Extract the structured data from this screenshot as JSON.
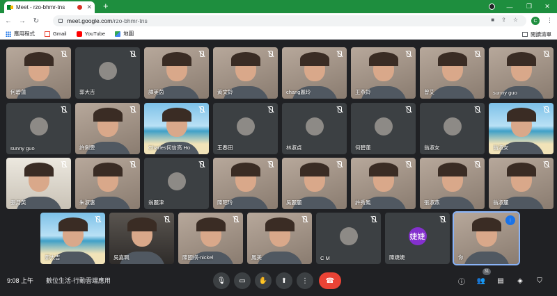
{
  "browser": {
    "tab_title": "Meet - rzo-bhmr-tns",
    "url_host": "meet.google.com",
    "url_path": "/rzo-bhmr-tns",
    "profile_letter": "C",
    "bookmarks": [
      {
        "label": "應用程式",
        "icon": "apps-grid-icon"
      },
      {
        "label": "Gmail",
        "icon": "gmail-icon"
      },
      {
        "label": "YouTube",
        "icon": "youtube-icon"
      },
      {
        "label": "地圖",
        "icon": "maps-icon"
      }
    ],
    "reading_list": "閱讀清單"
  },
  "meeting": {
    "time": "9:08 上午",
    "title": "數位生活-行動雲端應用",
    "participant_count": "31"
  },
  "participants": [
    {
      "name": "何碧蓮",
      "kind": "video"
    },
    {
      "name": "郭大吉",
      "kind": "avatar"
    },
    {
      "name": "譚美茵",
      "kind": "video"
    },
    {
      "name": "黃文鈴",
      "kind": "video"
    },
    {
      "name": "chang麗玲",
      "kind": "video"
    },
    {
      "name": "王燕鈴",
      "kind": "video"
    },
    {
      "name": "曾艾",
      "kind": "video"
    },
    {
      "name": "sunny guo",
      "kind": "video"
    },
    {
      "name": "sunny guo",
      "kind": "avatar"
    },
    {
      "name": "許俐雯",
      "kind": "video"
    },
    {
      "name": "Charles何信亮 Ho",
      "kind": "beach"
    },
    {
      "name": "王春田",
      "kind": "avatar"
    },
    {
      "name": "林淑貞",
      "kind": "avatar"
    },
    {
      "name": "何碧蓮",
      "kind": "avatar"
    },
    {
      "name": "翁淑女",
      "kind": "avatar"
    },
    {
      "name": "翁淑女",
      "kind": "beach"
    },
    {
      "name": "張月英",
      "kind": "room"
    },
    {
      "name": "朱淑惠",
      "kind": "video"
    },
    {
      "name": "翁麗津",
      "kind": "avatar"
    },
    {
      "name": "陳昭玲",
      "kind": "video"
    },
    {
      "name": "吳麗麗",
      "kind": "video"
    },
    {
      "name": "許秀鳳",
      "kind": "video"
    },
    {
      "name": "張淑燕",
      "kind": "video"
    },
    {
      "name": "翁淑麗",
      "kind": "video"
    },
    {
      "name": "郭大吉",
      "kind": "beach"
    },
    {
      "name": "吳嘉珮",
      "kind": "dark"
    },
    {
      "name": "陳國棋-nickel",
      "kind": "video"
    },
    {
      "name": "鳳美",
      "kind": "video"
    },
    {
      "name": "C M",
      "kind": "avatar"
    },
    {
      "name": "陳婕婕",
      "kind": "letter",
      "letter": "婕婕"
    },
    {
      "name": "你",
      "kind": "self"
    }
  ],
  "controls": {
    "mic": "microphone-icon",
    "camera": "camera-icon",
    "hand": "raise-hand-icon",
    "present": "present-screen-icon",
    "more": "more-options-icon",
    "end": "end-call-icon"
  },
  "colors": {
    "tab_strip": "#1e8e3e",
    "end_call": "#ea4335",
    "self_outline": "#8ab4f8",
    "background": "#202124"
  }
}
